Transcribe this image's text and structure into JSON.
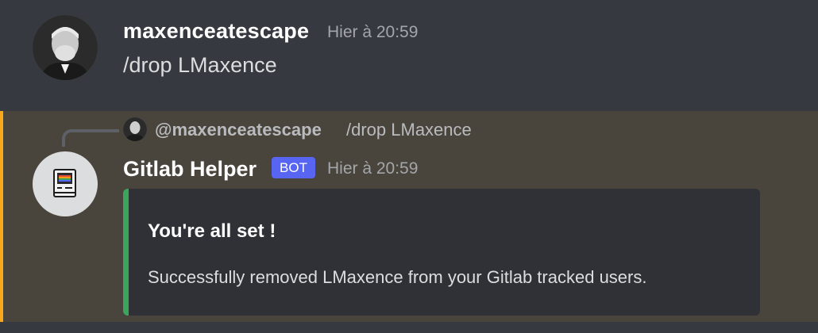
{
  "messages": [
    {
      "author": "maxenceatescape",
      "timestamp": "Hier à 20:59",
      "content": "/drop LMaxence"
    },
    {
      "author": "Gitlab Helper",
      "badge": "BOT",
      "timestamp": "Hier à 20:59",
      "reply": {
        "user": "@maxenceatescape",
        "content": "/drop LMaxence"
      },
      "embed": {
        "title": "You're all set !",
        "description": "Successfully removed LMaxence from your Gitlab tracked users.",
        "accent_color": "#3ba55c"
      }
    }
  ],
  "colors": {
    "background": "#36393f",
    "mention_highlight": "#49443c",
    "mention_bar": "#faa81a",
    "bot_badge": "#5865f2"
  },
  "icons": {
    "user_avatar": "user-avatar-photo",
    "bot_avatar": "retro-computer-icon"
  }
}
